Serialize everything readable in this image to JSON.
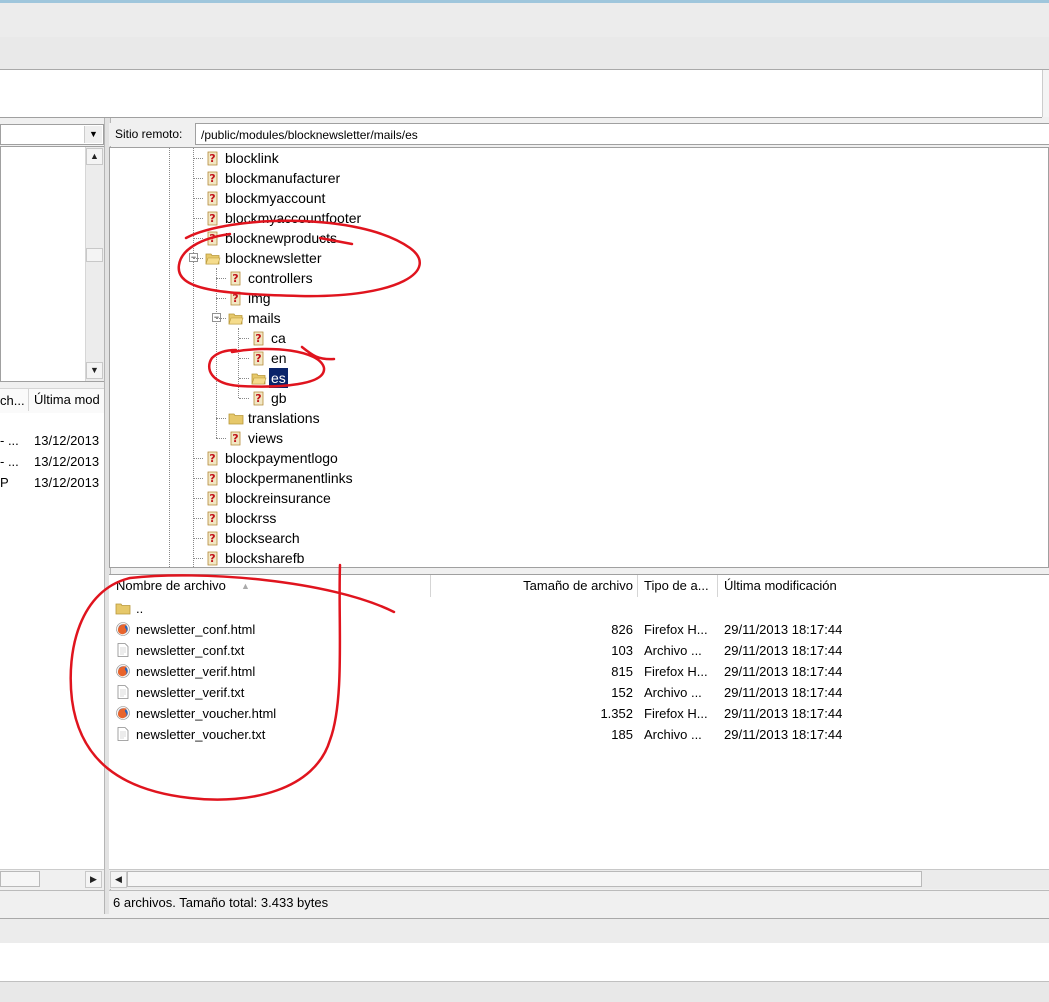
{
  "remote": {
    "site_label": "Sitio remoto:",
    "path": "/public/modules/blocknewsletter/mails/es",
    "tree": [
      {
        "label": "blocklink",
        "icon": "unknown-folder-icon"
      },
      {
        "label": "blockmanufacturer",
        "icon": "unknown-folder-icon"
      },
      {
        "label": "blockmyaccount",
        "icon": "unknown-folder-icon"
      },
      {
        "label": "blockmyaccountfooter",
        "icon": "unknown-folder-icon"
      },
      {
        "label": "blocknewproducts",
        "icon": "unknown-folder-icon"
      },
      {
        "label": "blocknewsletter",
        "icon": "open-folder-icon",
        "expanded": true
      },
      {
        "label": "controllers",
        "icon": "unknown-folder-icon"
      },
      {
        "label": "img",
        "icon": "unknown-folder-icon"
      },
      {
        "label": "mails",
        "icon": "open-folder-icon",
        "expanded": true
      },
      {
        "label": "ca",
        "icon": "unknown-folder-icon"
      },
      {
        "label": "en",
        "icon": "unknown-folder-icon"
      },
      {
        "label": "es",
        "icon": "open-folder-icon",
        "selected": true
      },
      {
        "label": "gb",
        "icon": "unknown-folder-icon"
      },
      {
        "label": "translations",
        "icon": "folder-icon"
      },
      {
        "label": "views",
        "icon": "unknown-folder-icon"
      },
      {
        "label": "blockpaymentlogo",
        "icon": "unknown-folder-icon"
      },
      {
        "label": "blockpermanentlinks",
        "icon": "unknown-folder-icon"
      },
      {
        "label": "blockreinsurance",
        "icon": "unknown-folder-icon"
      },
      {
        "label": "blockrss",
        "icon": "unknown-folder-icon"
      },
      {
        "label": "blocksearch",
        "icon": "unknown-folder-icon"
      },
      {
        "label": "blocksharefb",
        "icon": "unknown-folder-icon"
      }
    ],
    "columns": {
      "name": "Nombre de archivo",
      "size": "Tamaño de archivo",
      "type": "Tipo de a...",
      "modified": "Última modificación"
    },
    "parent_dir": "..",
    "files": [
      {
        "name": "newsletter_conf.html",
        "size": "826",
        "type": "Firefox H...",
        "modified": "29/11/2013 18:17:44",
        "icon": "firefox-html-icon"
      },
      {
        "name": "newsletter_conf.txt",
        "size": "103",
        "type": "Archivo ...",
        "modified": "29/11/2013 18:17:44",
        "icon": "text-file-icon"
      },
      {
        "name": "newsletter_verif.html",
        "size": "815",
        "type": "Firefox H...",
        "modified": "29/11/2013 18:17:44",
        "icon": "firefox-html-icon"
      },
      {
        "name": "newsletter_verif.txt",
        "size": "152",
        "type": "Archivo ...",
        "modified": "29/11/2013 18:17:44",
        "icon": "text-file-icon"
      },
      {
        "name": "newsletter_voucher.html",
        "size": "1.352",
        "type": "Firefox H...",
        "modified": "29/11/2013 18:17:44",
        "icon": "firefox-html-icon"
      },
      {
        "name": "newsletter_voucher.txt",
        "size": "185",
        "type": "Archivo ...",
        "modified": "29/11/2013 18:17:44",
        "icon": "text-file-icon"
      }
    ],
    "status": "6 archivos. Tamaño total: 3.433 bytes"
  },
  "local": {
    "columns": {
      "type_trunc": "ch...",
      "modified_trunc": "Última mod"
    },
    "rows": [
      {
        "type": "- ...",
        "modified": "13/12/2013"
      },
      {
        "type": "- ...",
        "modified": "13/12/2013"
      },
      {
        "type": "P",
        "modified": "13/12/2013"
      }
    ]
  },
  "colors": {
    "selection": "#0a246a",
    "annotation": "#e0141e"
  }
}
